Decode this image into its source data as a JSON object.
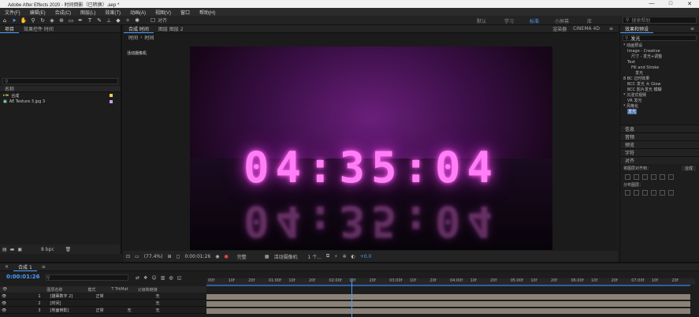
{
  "app": {
    "title": "Adobe After Effects 2020 - 时间倒影（已转换）.aep *",
    "win_min": "—",
    "win_max": "□",
    "win_close": "✕"
  },
  "menu": [
    "文件(F)",
    "编辑(E)",
    "合成(C)",
    "图层(L)",
    "效果(T)",
    "动画(A)",
    "视图(V)",
    "窗口",
    "帮助(H)"
  ],
  "toolbar": {
    "snap_label": "对齐"
  },
  "workspaces": {
    "default": "默认",
    "learn": "学习",
    "standard": "标准",
    "small": "小屏幕",
    "libraries": "库"
  },
  "search_help": {
    "placeholder": "搜索帮助"
  },
  "project": {
    "tabs": [
      "项目",
      "效果控件 时间"
    ],
    "column_name": "名称",
    "items": [
      {
        "name": "合成",
        "color": "#e8d44a"
      },
      {
        "name": "AE Texture 3.jpg 3",
        "color": "#c9a0ff"
      }
    ],
    "footer_bpc": "8 bpc"
  },
  "viewer": {
    "tabs": [
      "合成 时间",
      "图层 图层 2"
    ],
    "breadcrumb": [
      "时间",
      "时间"
    ],
    "renderer_label": "渲染器",
    "renderer": "CINEMA 4D",
    "active_camera_label": "活动摄像机",
    "clock_text": "04:35:04",
    "zoom": "(77.4%)",
    "timecode": "0:00:01:26",
    "quality": "完整",
    "camera": "活动摄像机",
    "views": "1 个...",
    "exposure": "+0.0"
  },
  "effects_panel": {
    "title": "效果和预设",
    "search": "发光",
    "items": [
      {
        "label": "* 动画预设",
        "indent": 0
      },
      {
        "label": "Image - Creative",
        "indent": 1
      },
      {
        "label": "尺寸 - 发光+调整",
        "indent": 2
      },
      {
        "label": "Text",
        "indent": 1
      },
      {
        "label": "Fill and Stroke",
        "indent": 2
      },
      {
        "label": "发光",
        "indent": 3
      },
      {
        "label": "8 BC 过时效果",
        "indent": 0
      },
      {
        "label": "BCC 发光 大 Glow",
        "indent": 1
      },
      {
        "label": "BCC 影片发光 模糊",
        "indent": 1
      },
      {
        "label": "* 沉浸式视频",
        "indent": 0
      },
      {
        "label": "VR 发光",
        "indent": 1
      },
      {
        "label": "* 风格化",
        "indent": 0
      },
      {
        "label": "发光",
        "indent": 1,
        "selected": true
      }
    ],
    "sections": [
      "信息",
      "音频",
      "预览",
      "字符",
      "对齐"
    ],
    "align_to_label": "将图层对齐到：",
    "align_to_value": "合成",
    "distribute_label": "分布图层："
  },
  "timeline": {
    "tab": "合成 1",
    "timecode": "0:00:01:26",
    "ruler_ticks": [
      "00f",
      "10f",
      "20f",
      "01:00f",
      "10f",
      "20f",
      "02:00f",
      "10f",
      "20f",
      "03:00f",
      "10f",
      "20f",
      "04:00f",
      "10f",
      "20f",
      "05:00f",
      "10f",
      "20f",
      "06:00f",
      "10f",
      "20f",
      "07:00f",
      "10f",
      "20f"
    ],
    "col_layer_name": "图层名称",
    "col_mode": "模式",
    "col_trkmat": "T TrkMat",
    "col_parent": "父级和链接",
    "layers": [
      {
        "num": "1",
        "name": "[描摹数字 2]",
        "mode": "正常",
        "trkmat": "",
        "parent": "无"
      },
      {
        "num": "2",
        "name": "[时间]",
        "mode": "",
        "trkmat": "",
        "parent": "无"
      },
      {
        "num": "3",
        "name": "[地面倒影]",
        "mode": "正常",
        "trkmat": "无",
        "parent": "无"
      }
    ],
    "progress": 0.3
  },
  "colors": {
    "accent": "#4a9dff",
    "glow": "#ff7ef5",
    "track": "#8a8276"
  }
}
